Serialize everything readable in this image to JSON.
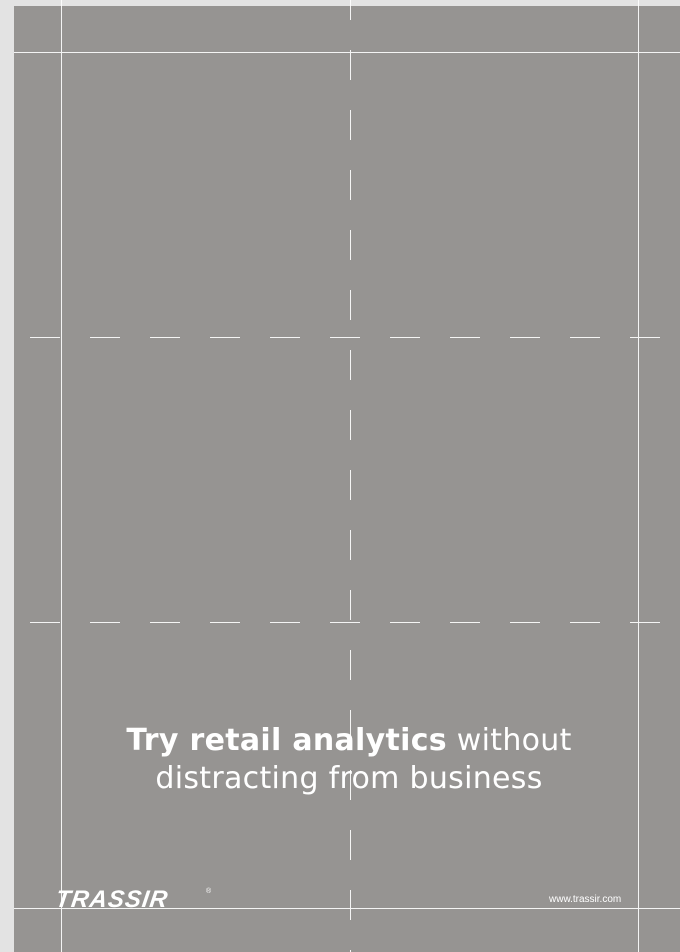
{
  "headline": {
    "bold": "Try retail analytics",
    "rest_line1": " without",
    "line2": "distracting from business"
  },
  "brand": {
    "logo_text": "TRASSIR",
    "registered_mark": "®",
    "website": "www.trassir.com"
  },
  "colors": {
    "page_background": "#969492",
    "outer_background": "#e3e3e3",
    "guide_lines": "#ffffff"
  }
}
